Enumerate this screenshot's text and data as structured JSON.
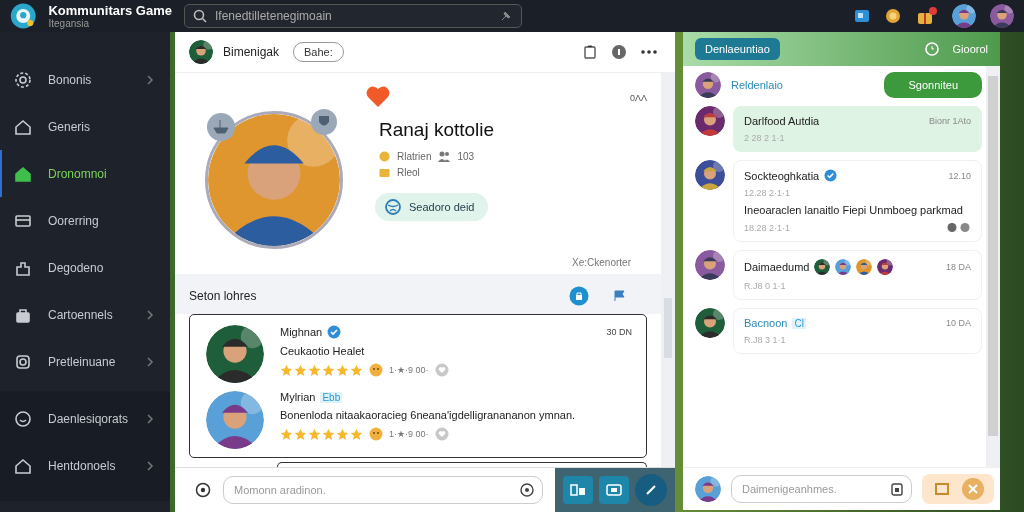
{
  "app": {
    "title": "Kommunitars Game",
    "subtitle": "Itegansia"
  },
  "search": {
    "placeholder": "Ifenedtilletenegimoain"
  },
  "sidebar": {
    "items": [
      {
        "label": "Bononis",
        "chevron": true,
        "selected": false
      },
      {
        "label": "Generis",
        "chevron": false,
        "selected": false
      },
      {
        "label": "Dronomnoi",
        "chevron": false,
        "selected": true
      },
      {
        "label": "Oorerring",
        "chevron": false,
        "selected": false
      },
      {
        "label": "Degodeno",
        "chevron": false,
        "selected": false
      },
      {
        "label": "Cartoennels",
        "chevron": true,
        "selected": false
      },
      {
        "label": "Pretleinuane",
        "chevron": true,
        "selected": false
      }
    ],
    "footer_items": [
      {
        "label": "Daenlesiqorats",
        "chevron": true,
        "selected": false
      },
      {
        "label": "Hentdonoels",
        "chevron": true,
        "selected": false
      }
    ]
  },
  "main": {
    "header": {
      "name": "Bimenigak",
      "pill": "Bahe:"
    },
    "profile": {
      "name": "Ranaj kottolie",
      "time": "0ΛΛ",
      "stat_1": "Rlatrien",
      "stat_2": "103",
      "stat_3": "Rleol",
      "button": "Seadoro deid",
      "link": "Xe:Ckenorter"
    },
    "section_title": "Seton lohres",
    "reviews": [
      {
        "name": "Mighnan",
        "verified": true,
        "time": "30 DN",
        "text": "Ceukaotio Healet",
        "stars": 6,
        "meta": "1·★·9 00·"
      },
      {
        "name": "Mylrian",
        "verified": false,
        "tag": "Ebb",
        "text": "Bonenloda nitaakaoracieg 6neana'igdelligranananon ymnan.",
        "stars": 6,
        "meta": "1·★·9 00·"
      }
    ],
    "composer": {
      "placeholder": "Momonn aradinon."
    }
  },
  "chat": {
    "header_button": "Denlaeuntiao",
    "header_label": "Gioorol",
    "user": "Reldenlaio",
    "user_button": "Sgonniteu",
    "messages": [
      {
        "name": "Darlfood Autdia",
        "time": "Bionr 1Ato",
        "meta": "2 28 2 1·1",
        "highlighted": true,
        "verified": false
      },
      {
        "name": "Sockteoghkatia",
        "time": "12.10",
        "meta": "12.28 2·1·1",
        "text": "Ineoaraclen lanaitlo Fiepi Unmboeg parkmad",
        "meta_2": "18.28 2·1·1",
        "highlighted": false,
        "verified": true
      },
      {
        "name": "Daimaedumd",
        "time": "18 DA",
        "meta": "R.J8 0 1·1",
        "highlighted": false,
        "verified": false
      },
      {
        "name": "Bacnoon",
        "tag": "Cl",
        "time": "10 DA",
        "meta": "R.J8 3 1·1",
        "highlighted": false,
        "verified": false
      }
    ],
    "composer": {
      "placeholder": "Daimenigeanhmes."
    }
  }
}
